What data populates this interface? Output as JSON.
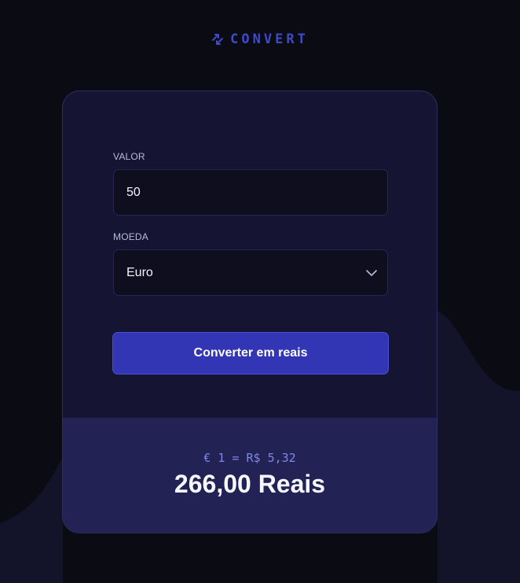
{
  "colors": {
    "background": "#0b0b14",
    "card": "#151533",
    "result_panel": "#222354",
    "accent": "#3336b4",
    "logo": "#3f4ac9"
  },
  "logo": {
    "icon": "swap-arrows-icon",
    "text": "CONVERT"
  },
  "form": {
    "amount_label": "VALOR",
    "amount_value": "50",
    "currency_label": "MOEDA",
    "currency_selected": "Euro",
    "submit_label": "Converter em reais"
  },
  "result": {
    "rate": "€ 1 = R$ 5,32",
    "total": "266,00 Reais"
  }
}
